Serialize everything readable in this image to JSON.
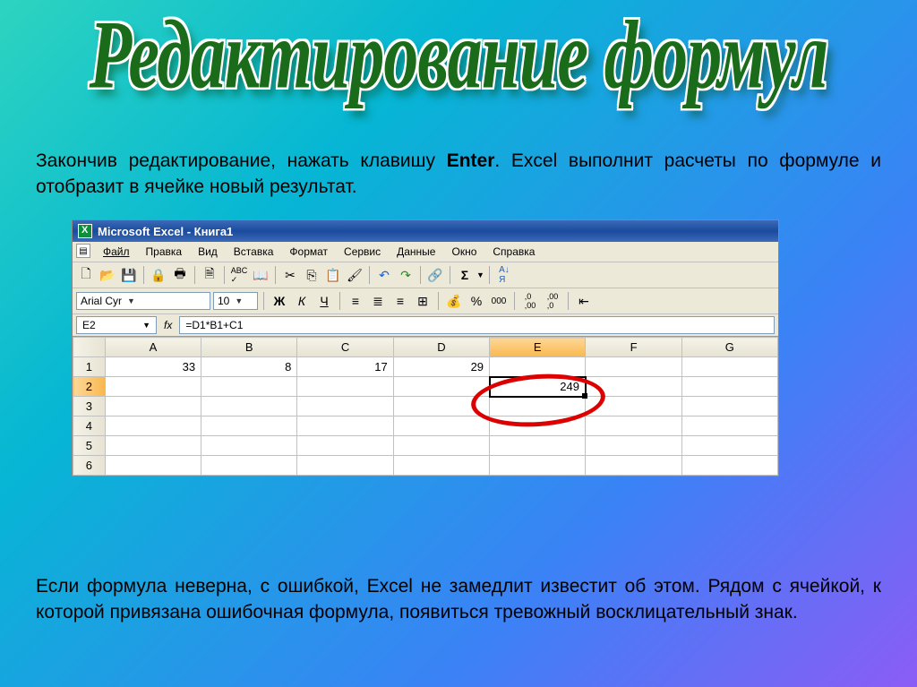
{
  "slide": {
    "title": "Редактирование формул",
    "desc_top_before": "Закончив редактирование, нажать клавишу ",
    "desc_top_bold": "Enter",
    "desc_top_after": ". Excel выполнит расчеты по формуле и отобразит в ячейке новый результат.",
    "desc_bottom": "Если формула неверна, с ошибкой, Excel не замедлит  известит об этом. Рядом с ячейкой, к которой привязана ошибочная формула, появиться тревожный восклицательный знак."
  },
  "excel": {
    "title": "Microsoft Excel - Книга1",
    "menu": [
      "Файл",
      "Правка",
      "Вид",
      "Вставка",
      "Формат",
      "Сервис",
      "Данные",
      "Окно",
      "Справка"
    ],
    "font_name": "Arial Cyr",
    "font_size": "10",
    "bold": "Ж",
    "italic": "К",
    "under": "Ч",
    "percent": "%",
    "thousand": "000",
    "name_box": "E2",
    "formula": "=D1*B1+C1",
    "columns": [
      "A",
      "B",
      "C",
      "D",
      "E",
      "F",
      "G"
    ],
    "rows": [
      {
        "n": "1",
        "cells": [
          "33",
          "8",
          "17",
          "29",
          "",
          "",
          ""
        ]
      },
      {
        "n": "2",
        "cells": [
          "",
          "",
          "",
          "",
          "249",
          "",
          ""
        ]
      },
      {
        "n": "3",
        "cells": [
          "",
          "",
          "",
          "",
          "",
          "",
          ""
        ]
      },
      {
        "n": "4",
        "cells": [
          "",
          "",
          "",
          "",
          "",
          "",
          ""
        ]
      },
      {
        "n": "5",
        "cells": [
          "",
          "",
          "",
          "",
          "",
          "",
          ""
        ]
      },
      {
        "n": "6",
        "cells": [
          "",
          "",
          "",
          "",
          "",
          "",
          ""
        ]
      }
    ]
  }
}
